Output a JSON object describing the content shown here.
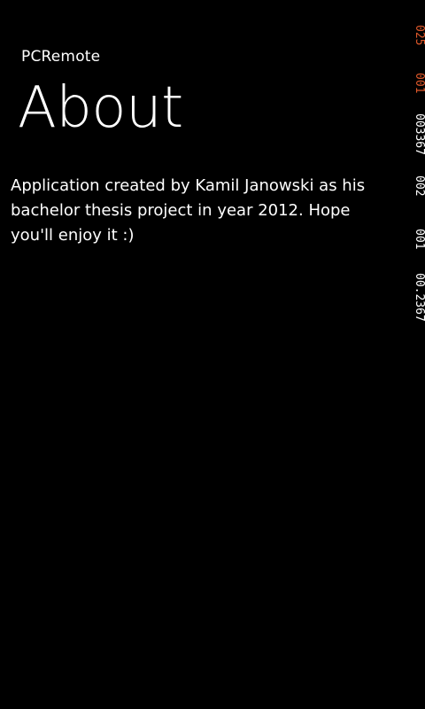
{
  "header": {
    "app_title": "PCRemote",
    "page_title": "About"
  },
  "content": {
    "about_text": "Application created by Kamil Janowski as his bachelor thesis project in year 2012. Hope you'll enjoy it :)"
  },
  "frame_rate_counters": {
    "render_fps": "025",
    "ui_fps": "001",
    "texture_memory": "003367",
    "surface_counter": "002",
    "intermediate_texture": "001",
    "fill_rate": "00.2367"
  },
  "colors": {
    "background": "#000000",
    "text": "#ffffff",
    "counter_accent": "#e0592b"
  }
}
